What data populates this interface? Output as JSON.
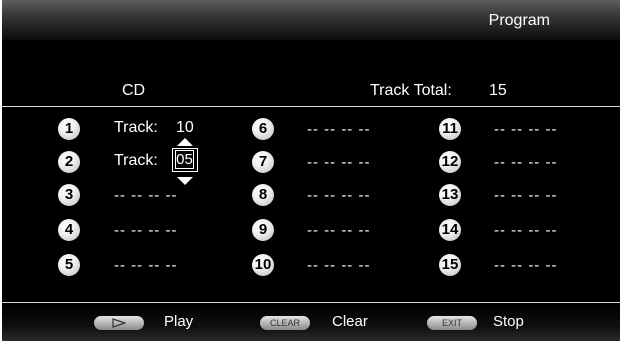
{
  "header": {
    "title": "Program"
  },
  "info": {
    "source_label": "CD",
    "track_total_label": "Track Total:",
    "track_total_value": "15"
  },
  "slots": [
    {
      "num": "1",
      "label": "Track:",
      "value": "10"
    },
    {
      "num": "2",
      "label": "Track:",
      "value": "05",
      "editing": true
    },
    {
      "num": "3",
      "value": "-- -- -- --"
    },
    {
      "num": "4",
      "value": "-- -- -- --"
    },
    {
      "num": "5",
      "value": "-- -- -- --"
    },
    {
      "num": "6",
      "value": "-- -- -- --"
    },
    {
      "num": "7",
      "value": "-- -- -- --"
    },
    {
      "num": "8",
      "value": "-- -- -- --"
    },
    {
      "num": "9",
      "value": "-- -- -- --"
    },
    {
      "num": "10",
      "value": "-- -- -- --"
    },
    {
      "num": "11",
      "value": "-- -- -- --"
    },
    {
      "num": "12",
      "value": "-- -- -- --"
    },
    {
      "num": "13",
      "value": "-- -- -- --"
    },
    {
      "num": "14",
      "value": "-- -- -- --"
    },
    {
      "num": "15",
      "value": "-- -- -- --"
    }
  ],
  "footer": {
    "play": {
      "button_icon": "play-icon",
      "label": "Play"
    },
    "clear": {
      "button_text": "CLEAR",
      "label": "Clear"
    },
    "exit": {
      "button_text": "EXIT",
      "label": "Stop"
    }
  }
}
